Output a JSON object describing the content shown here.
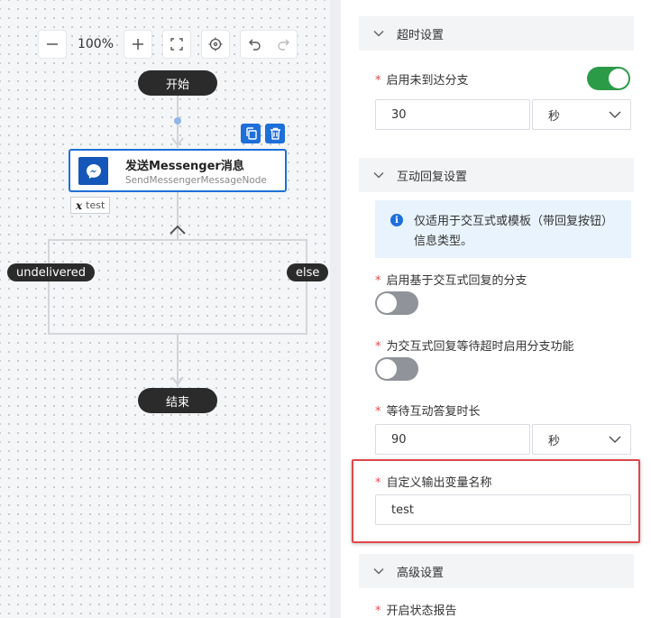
{
  "toolbar": {
    "zoom_level": "100%",
    "zoom_out": "zoom-out",
    "zoom_in": "zoom-in",
    "fit": "fit-view",
    "locate": "locate",
    "undo": "undo",
    "redo": "redo"
  },
  "flow": {
    "start_label": "开始",
    "end_label": "结束",
    "node": {
      "title": "发送Messenger消息",
      "subtitle": "SendMessengerMessageNode",
      "icon": "messenger-icon",
      "actions": [
        "copy-icon",
        "delete-icon"
      ]
    },
    "variable_tag": {
      "symbol": "x",
      "name": "test"
    },
    "branch_left": "undelivered",
    "branch_right": "else"
  },
  "panel": {
    "timeout_section": {
      "title": "超时设置",
      "enable_unreached_branch": {
        "label": "启用未到达分支",
        "required": "*",
        "enabled": true
      },
      "duration": {
        "value": "30",
        "unit": "秒"
      }
    },
    "interactive_section": {
      "title": "互动回复设置",
      "info": "仅适用于交互式或模板（带回复按钮）信息类型。",
      "enable_interactive_branch": {
        "label": "启用基于交互式回复的分支",
        "required": "*",
        "enabled": false
      },
      "enable_timeout_branch": {
        "label": "为交互式回复等待超时启用分支功能",
        "required": "*",
        "enabled": false
      },
      "wait_duration": {
        "label": "等待互动答复时长",
        "required": "*",
        "value": "90",
        "unit": "秒"
      },
      "output_variable": {
        "label": "自定义输出变量名称",
        "required": "*",
        "value": "test"
      }
    },
    "advanced_section": {
      "title": "高级设置",
      "status_report": {
        "label": "开启状态报告",
        "required": "*"
      }
    }
  },
  "colors": {
    "accent_blue": "#1e6fd9",
    "toggle_on": "#2c9b48",
    "toggle_off": "#909399",
    "highlight_red": "#e0474c",
    "required_red": "#e5484d"
  }
}
